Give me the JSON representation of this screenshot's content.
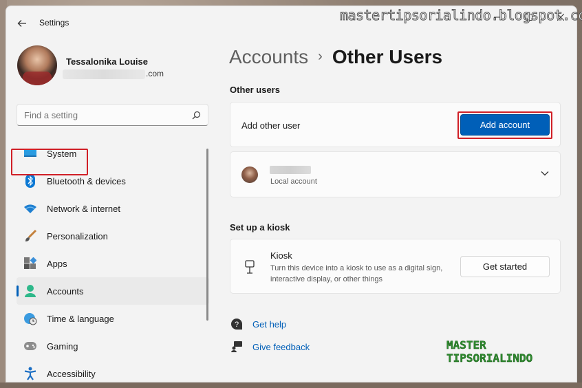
{
  "window": {
    "title": "Settings",
    "watermark": "mastertipsorialindo.blogspot.com"
  },
  "profile": {
    "name": "Tessalonika Louise",
    "email_suffix": ".com"
  },
  "search": {
    "placeholder": "Find a setting"
  },
  "sidebar": {
    "items": [
      {
        "label": "System",
        "icon": "system-icon"
      },
      {
        "label": "Bluetooth & devices",
        "icon": "bluetooth-icon"
      },
      {
        "label": "Network & internet",
        "icon": "wifi-icon"
      },
      {
        "label": "Personalization",
        "icon": "brush-icon"
      },
      {
        "label": "Apps",
        "icon": "apps-icon"
      },
      {
        "label": "Accounts",
        "icon": "accounts-icon",
        "active": true
      },
      {
        "label": "Time & language",
        "icon": "globe-clock-icon"
      },
      {
        "label": "Gaming",
        "icon": "gamepad-icon"
      },
      {
        "label": "Accessibility",
        "icon": "accessibility-icon"
      }
    ]
  },
  "breadcrumb": {
    "parent": "Accounts",
    "separator": "›",
    "current": "Other Users"
  },
  "other_users": {
    "heading": "Other users",
    "add_label": "Add other user",
    "add_button": "Add account",
    "local_account_label": "Local account"
  },
  "kiosk": {
    "heading": "Set up a kiosk",
    "title": "Kiosk",
    "description": "Turn this device into a kiosk to use as a digital sign, interactive display, or other things",
    "button": "Get started"
  },
  "links": {
    "help": "Get help",
    "feedback": "Give feedback"
  },
  "brand": {
    "line1": "MASTER",
    "line2": "TIPSORIALINDO"
  },
  "colors": {
    "accent": "#005fb8",
    "highlight": "#d01f26"
  }
}
